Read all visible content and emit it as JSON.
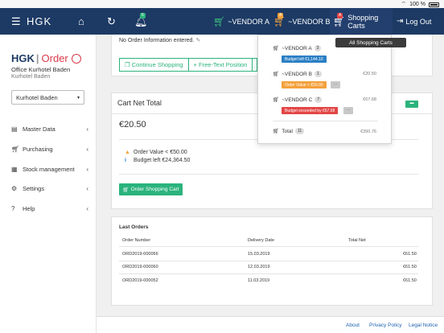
{
  "statusbar": {
    "battery": "100 %"
  },
  "navbar": {
    "brand": "HGK",
    "bell_badge": "6",
    "vendor_a_label": "~VENDOR A",
    "vendor_b_label": "~VENDOR B",
    "vendor_b_badge": "A",
    "shopping_carts_label": "Shopping Carts",
    "shopping_carts_badge": "A",
    "logout_label": "Log Out",
    "tooltip": "All Shopping Carts"
  },
  "sidebar": {
    "logo_brand": "HGK",
    "logo_order": "Order",
    "office": "Office Kurhotel Baden",
    "suboffice": "Kurhotel Baden",
    "select_value": "Kurhotel Baden",
    "items": [
      {
        "label": "Master Data",
        "icon": "book-icon"
      },
      {
        "label": "Purchasing",
        "icon": "cart-icon"
      },
      {
        "label": "Stock management",
        "icon": "warehouse-icon"
      },
      {
        "label": "Settings",
        "icon": "gear-icon"
      },
      {
        "label": "Help",
        "icon": "question-icon"
      }
    ]
  },
  "main": {
    "no_order": "No Order Information entered.",
    "continue_shopping": "Continue Shopping",
    "free_text": "+ Free-Text Position",
    "cart_net_title": "Cart Net Total",
    "cart_net_value": "€20.50",
    "warn_order_value": "Order Value < €50.00",
    "budget_left": "Budget left €24,364.50",
    "order_button": "Order Shopping Cart",
    "last_orders_title": "Last Orders",
    "columns": [
      "Order Number",
      "Delivery Date",
      "Total Net"
    ],
    "orders": [
      {
        "number": "ORD2019-000066",
        "date": "15.03.2019",
        "total": "€61.50"
      },
      {
        "number": "ORD2019-000060",
        "date": "12.03.2019",
        "total": "€61.50"
      },
      {
        "number": "ORD2019-000052",
        "date": "11.03.2019",
        "total": "€61.50"
      }
    ]
  },
  "dropdown": {
    "vendors": [
      {
        "name": "~VENDOR A",
        "count": "3",
        "amount": "",
        "tag": "Budget left €1,144.10",
        "tag_type": "info",
        "more": false
      },
      {
        "name": "~VENDOR B",
        "count": "1",
        "amount": "€20.50",
        "tag": "Order Value < €50.00",
        "tag_type": "warn",
        "more": true
      },
      {
        "name": "~VENDOR C",
        "count": "7",
        "amount": "€67.68",
        "tag": "Budget exceeded by €67.68",
        "tag_type": "danger",
        "more": true
      }
    ],
    "total_label": "Total",
    "total_count": "11",
    "total_amount": "€350.76"
  },
  "footer": {
    "about": "About",
    "privacy": "Privacy Policy",
    "legal": "Legal Notice"
  },
  "colors": {
    "navbar": "#1c3a64",
    "accent": "#2bb37c",
    "warn": "#f4a13c",
    "danger": "#e34545",
    "info": "#2b7fc4"
  }
}
